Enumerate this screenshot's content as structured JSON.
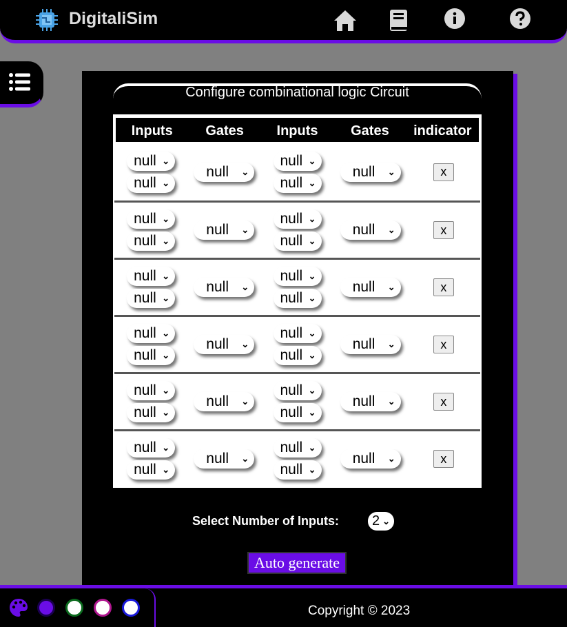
{
  "header": {
    "app_title": "DigitaliSim",
    "nav": [
      "home-icon",
      "book-icon",
      "info-icon",
      "help-icon"
    ]
  },
  "sidebar": {
    "toggle_icon": "list-icon"
  },
  "panel": {
    "title": "Configure combinational logic Circuit",
    "columns": [
      "Inputs",
      "Gates",
      "Inputs",
      "Gates",
      "indicator"
    ],
    "rows": [
      {
        "in1": [
          "null",
          "null"
        ],
        "gate1": "null",
        "in2": [
          "null",
          "null"
        ],
        "gate2": "null",
        "indicator": "x"
      },
      {
        "in1": [
          "null",
          "null"
        ],
        "gate1": "null",
        "in2": [
          "null",
          "null"
        ],
        "gate2": "null",
        "indicator": "x"
      },
      {
        "in1": [
          "null",
          "null"
        ],
        "gate1": "null",
        "in2": [
          "null",
          "null"
        ],
        "gate2": "null",
        "indicator": "x"
      },
      {
        "in1": [
          "null",
          "null"
        ],
        "gate1": "null",
        "in2": [
          "null",
          "null"
        ],
        "gate2": "null",
        "indicator": "x"
      },
      {
        "in1": [
          "null",
          "null"
        ],
        "gate1": "null",
        "in2": [
          "null",
          "null"
        ],
        "gate2": "null",
        "indicator": "x"
      },
      {
        "in1": [
          "null",
          "null"
        ],
        "gate1": "null",
        "in2": [
          "null",
          "null"
        ],
        "gate2": "null",
        "indicator": "x"
      }
    ],
    "num_inputs_label": "Select Number of Inputs:",
    "num_inputs_value": "2",
    "auto_generate_label": "Auto generate"
  },
  "footer": {
    "copyright": "Copyright © 2023",
    "theme_swatches": [
      {
        "fill": "#6a0de6",
        "ring": "#1a0050"
      },
      {
        "fill": "#ffffff",
        "ring": "#0b6b1e"
      },
      {
        "fill": "#ffffff",
        "ring": "#b0168f"
      },
      {
        "fill": "#ffffff",
        "ring": "#1a1adb"
      }
    ]
  },
  "colors": {
    "accent": "#6a0de6",
    "background": "#808080",
    "panel": "#000000"
  }
}
